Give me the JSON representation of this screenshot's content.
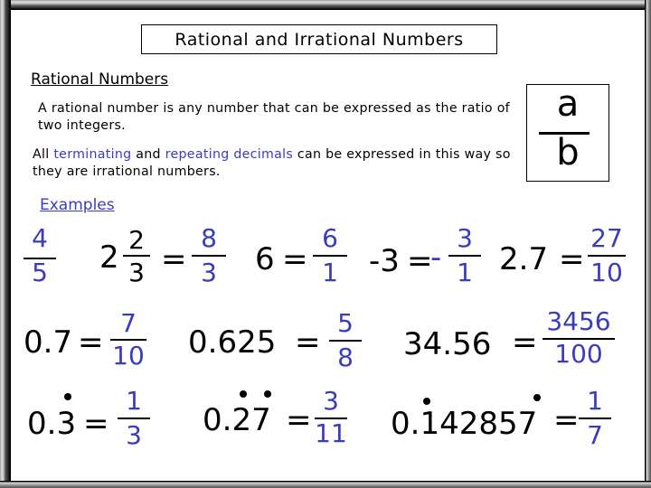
{
  "title": "Rational and Irrational Numbers",
  "section_heading": "Rational Numbers",
  "definition": "A rational number is any number that can be expressed as the ratio of two integers.",
  "decimals_note": {
    "prefix": "All ",
    "term1": "terminating",
    "middle": " and ",
    "term2": "repeating decimals",
    "suffix": " can be expressed in this way so they are irrational numbers."
  },
  "ab_fraction": {
    "numerator": "a",
    "denominator": "b"
  },
  "examples_label": "Examples",
  "colors": {
    "accent_blue": "#3b3bbf",
    "text": "#000000"
  },
  "examples": {
    "e1": {
      "num": "4",
      "den": "5"
    },
    "e2": {
      "whole": "2",
      "num": "2",
      "den": "3",
      "eq": "=",
      "rnum": "8",
      "rden": "3"
    },
    "e3": {
      "lhs": "6",
      "eq": "=",
      "rnum": "6",
      "rden": "1"
    },
    "e4": {
      "lhs": "-3",
      "eq": "=",
      "sign": "-",
      "rnum": "3",
      "rden": "1"
    },
    "e5": {
      "lhs": "2.7",
      "eq": "=",
      "rnum": "27",
      "rden": "10"
    },
    "e6": {
      "lhs": "0.7",
      "eq": "=",
      "rnum": "7",
      "rden": "10"
    },
    "e7": {
      "lhs": "0.625",
      "eq": "=",
      "rnum": "5",
      "rden": "8"
    },
    "e8": {
      "lhs": "34.56",
      "eq": "=",
      "rnum": "3456",
      "rden": "100"
    },
    "e9": {
      "lhs": "0.3",
      "eq": "=",
      "rnum": "1",
      "rden": "3",
      "repeating": "3"
    },
    "e10": {
      "lhs": "0.27",
      "eq": "=",
      "rnum": "3",
      "rden": "11",
      "repeating": "27"
    },
    "e11": {
      "lhs": "0.142857",
      "eq": "=",
      "rnum": "1",
      "rden": "7",
      "repeating": "142857"
    }
  }
}
